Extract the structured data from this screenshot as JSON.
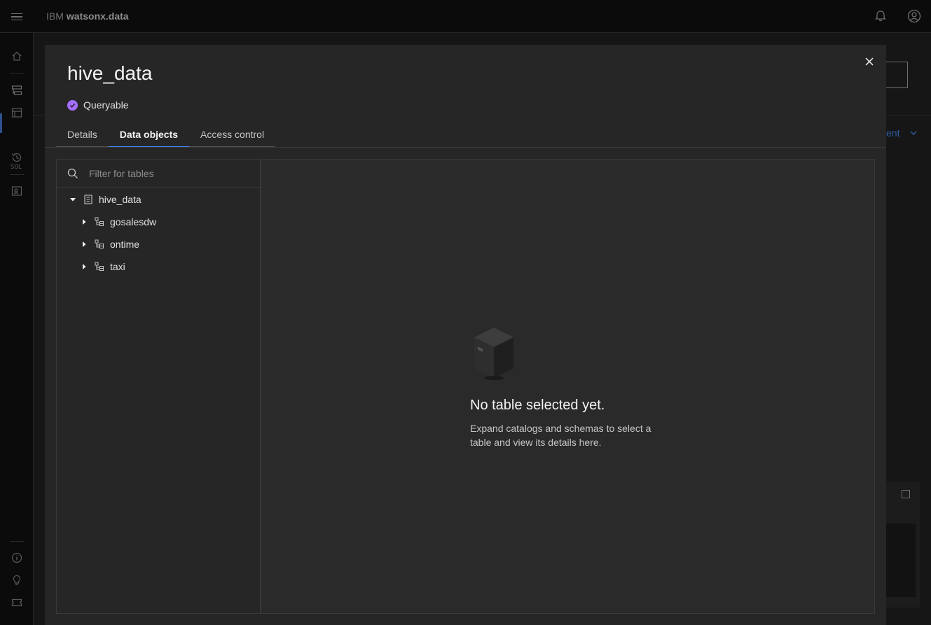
{
  "app": {
    "brand_prefix": "IBM",
    "brand_name": "watsonx.data"
  },
  "nav": {
    "sql_label": "SQL"
  },
  "background": {
    "partial_label": "ent"
  },
  "modal": {
    "title": "hive_data",
    "status_label": "Queryable",
    "tabs": [
      {
        "label": "Details",
        "active": false
      },
      {
        "label": "Data objects",
        "active": true
      },
      {
        "label": "Access control",
        "active": false
      }
    ],
    "search": {
      "placeholder": "Filter for tables",
      "value": ""
    },
    "tree": {
      "root": {
        "label": "hive_data",
        "expanded": true
      },
      "schemas": [
        {
          "label": "gosalesdw",
          "expanded": false
        },
        {
          "label": "ontime",
          "expanded": false
        },
        {
          "label": "taxi",
          "expanded": false
        }
      ]
    },
    "empty_state": {
      "title": "No table selected yet.",
      "description": "Expand catalogs and schemas to select a table and view its details here."
    }
  },
  "colors": {
    "accent": "#4589ff",
    "status": "#a56eff",
    "modal_bg": "#262626"
  }
}
